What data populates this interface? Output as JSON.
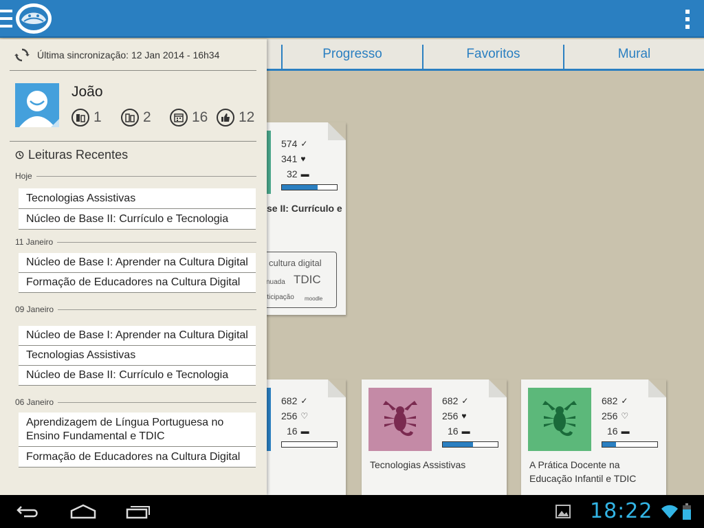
{
  "actionbar": {
    "menu_icon": "hamburger-icon",
    "logo_icon": "app-logo-icon",
    "overflow_icon": "more-vert-icon",
    "color": "#2a7fc1"
  },
  "tabs": [
    {
      "label": "Progresso"
    },
    {
      "label": "Favoritos"
    },
    {
      "label": "Mural"
    }
  ],
  "drawer": {
    "sync": {
      "icon": "sync-icon",
      "text": "Última sincronização: 12 Jan 2014 - 16h34"
    },
    "user": {
      "name": "João",
      "avatar_icon": "avatar-icon",
      "counters": [
        {
          "icon": "books-read-icon",
          "value": "1"
        },
        {
          "icon": "books-icon",
          "value": "2"
        },
        {
          "icon": "calendar-icon",
          "value": "16"
        },
        {
          "icon": "thumbs-up-icon",
          "value": "12"
        }
      ]
    },
    "recent": {
      "icon": "clock-icon",
      "title": "Leituras Recentes",
      "groups": [
        {
          "label": "Hoje",
          "items": [
            "Tecnologias Assistivas",
            "Núcleo de Base II: Currículo e Tecnologia"
          ]
        },
        {
          "label": "11 Janeiro",
          "items": [
            "Núcleo de Base I: Aprender na Cultura Digital",
            "Formação de Educadores na Cultura Digital"
          ]
        },
        {
          "label": "09 Janeiro",
          "items": [
            "Núcleo de Base I: Aprender na Cultura Digital",
            "Tecnologias Assistivas",
            "Núcleo de Base II: Currículo e Tecnologia"
          ]
        },
        {
          "label": "06 Janeiro",
          "items": [
            "Aprendizagem de Língua Portuguesa no Ensino Fundamental e TDIC",
            "Formação de Educadores na Cultura Digital"
          ]
        }
      ]
    }
  },
  "cards": [
    {
      "id": "top",
      "views": "574",
      "likes": "341",
      "comments": "32",
      "progress": 0.65,
      "title": "se II: Currículo e",
      "heart": "filled",
      "thumb_color": "#4aa88c"
    },
    {
      "id": "bottom-left",
      "views": "682",
      "likes": "256",
      "comments": "16",
      "progress": 0.0,
      "title": "",
      "heart": "outline",
      "thumb_color": "#2a7fc1"
    },
    {
      "id": "bottom-mid",
      "views": "682",
      "likes": "256",
      "comments": "16",
      "progress": 0.55,
      "title": "Tecnologias Assistivas",
      "heart": "filled",
      "thumb_color": "#c48aa6",
      "icon_color": "#7a2a50"
    },
    {
      "id": "bottom-right",
      "views": "682",
      "likes": "256",
      "comments": "16",
      "progress": 0.25,
      "title": "A Prática Docente na Educação Infantil e TDIC",
      "heart": "outline",
      "thumb_color": "#5cb87a",
      "icon_color": "#1a6a3a"
    }
  ],
  "tagcloud": {
    "words": [
      "cultura digital",
      "nuada",
      "TDIC",
      "rticipação",
      "moodle"
    ]
  },
  "statusbar": {
    "time": "18:22",
    "colors": {
      "clock": "#33b5e5"
    }
  }
}
